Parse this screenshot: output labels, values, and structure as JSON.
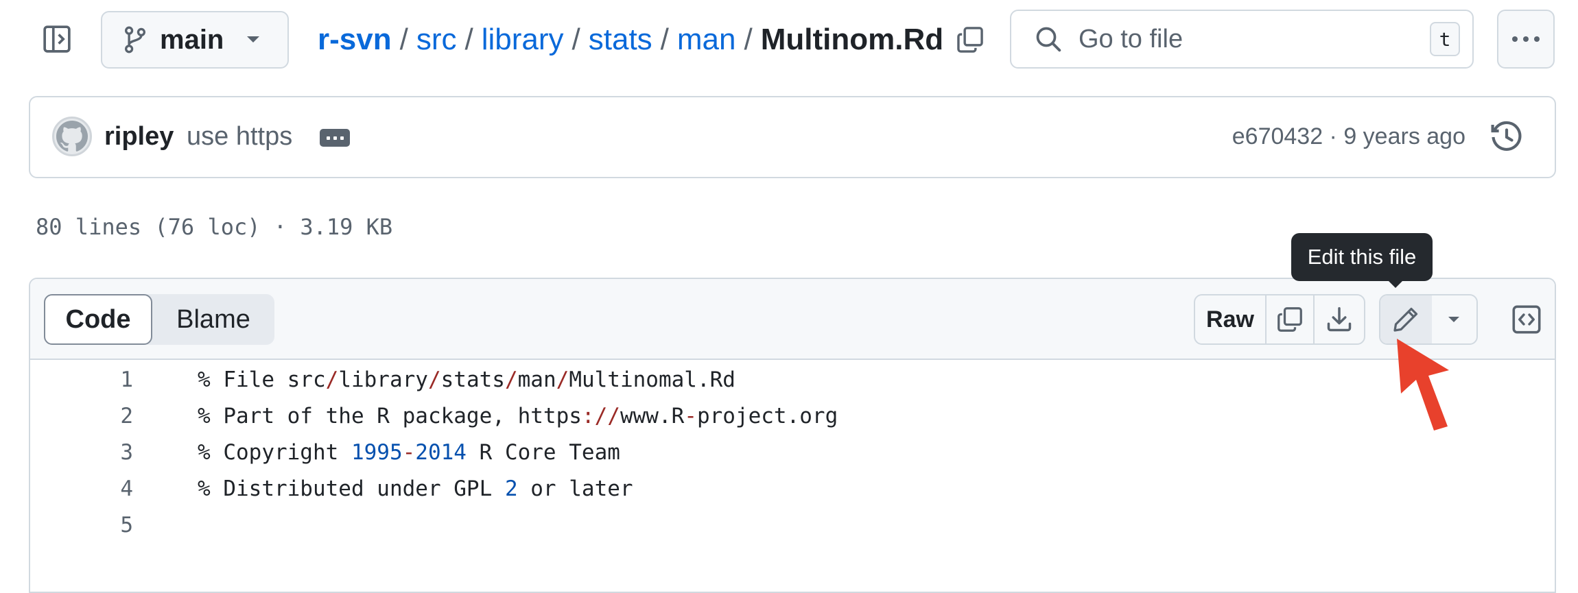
{
  "repo": {
    "branch": "main",
    "breadcrumb": [
      "r-svn",
      "src",
      "library",
      "stats",
      "man"
    ],
    "current_file": "Multinom.Rd"
  },
  "search": {
    "placeholder": "Go to file",
    "shortcut": "t"
  },
  "commit": {
    "author": "ripley",
    "message": "use https",
    "meta": "e670432 · 9 years ago"
  },
  "file": {
    "info": "80 lines (76 loc) · 3.19 KB",
    "tabs": [
      "Code",
      "Blame"
    ],
    "raw_label": "Raw",
    "tooltip": "Edit this file"
  },
  "code_lines": [
    {
      "n": "1",
      "text": "% File src/library/stats/man/Multinomal.Rd"
    },
    {
      "n": "2",
      "text": "% Part of the R package, https://www.R-project.org"
    },
    {
      "n": "3",
      "text": "% Copyright 1995-2014 R Core Team"
    },
    {
      "n": "4",
      "text": "% Distributed under GPL 2 or later"
    },
    {
      "n": "5",
      "text": ""
    }
  ],
  "colors": {
    "link": "#0969da",
    "annotation_arrow": "#e8412c",
    "tooltip_bg": "#25292e"
  },
  "icons": [
    "sidebar-toggle-icon",
    "git-branch-icon",
    "caret-down-icon",
    "copy-icon",
    "search-icon",
    "kebab-horizontal-icon",
    "github-avatar-icon",
    "history-icon",
    "download-icon",
    "pencil-icon",
    "code-square-icon",
    "red-arrow-icon"
  ]
}
